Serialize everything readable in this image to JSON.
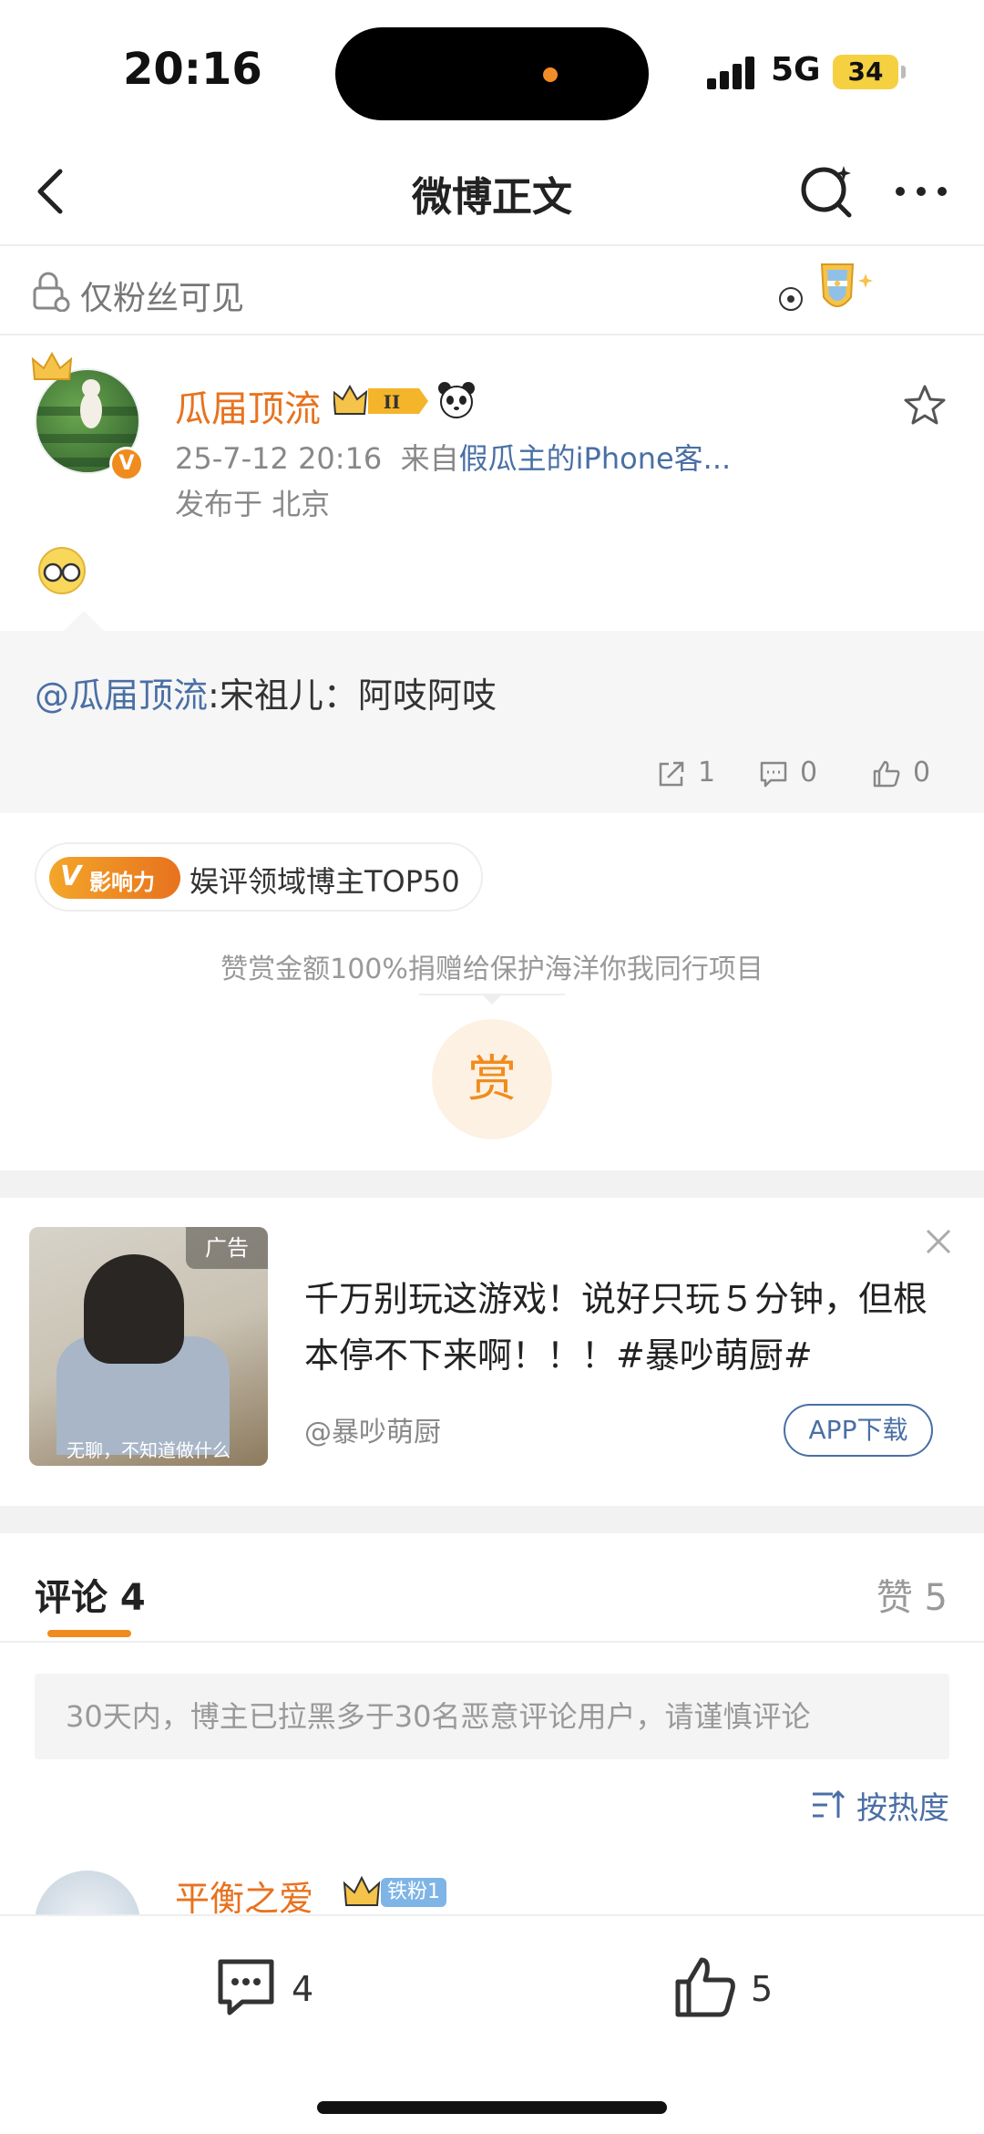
{
  "status_bar": {
    "time": "20:16",
    "network": "5G",
    "battery": "34"
  },
  "nav": {
    "title": "微博正文"
  },
  "visibility": {
    "label": "仅粉丝可见"
  },
  "post": {
    "author": "瓜届顶流",
    "level_badge": "II",
    "time": "25-7-12 20:16",
    "from_prefix": "来自",
    "source": "假瓜主的iPhone客...",
    "location": "发布于 北京"
  },
  "repost": {
    "mention": "@瓜届顶流",
    "text": ":宋祖儿：阿吱阿吱",
    "shares": "1",
    "comments": "0",
    "likes": "0"
  },
  "influence": {
    "badge_v": "V",
    "badge_text": "影响力",
    "label": "娱评领域博主TOP50"
  },
  "reward": {
    "note": "赞赏金额100%捐赠给保护海洋你我同行项目",
    "button": "赏"
  },
  "ad": {
    "tag": "广告",
    "caption": "无聊，不知道做什么",
    "text": "千万别玩这游戏！说好只玩５分钟，但根本停不下来啊！！！#暴吵萌厨#",
    "source": "@暴吵萌厨",
    "download": "APP下载"
  },
  "comments_section": {
    "tab_comments": "评论 4",
    "tab_likes": "赞 5",
    "warning": "30天内，博主已拉黑多于30名恶意评论用户，请谨慎评论",
    "sort": "按热度",
    "first_comment_user": "平衡之爱_",
    "first_comment_fan_badge": "铁粉1"
  },
  "bottom_bar": {
    "comments": "4",
    "likes": "5"
  },
  "colors": {
    "accent": "#f08c1d",
    "link": "#4a6fa5",
    "username": "#e8721e"
  }
}
